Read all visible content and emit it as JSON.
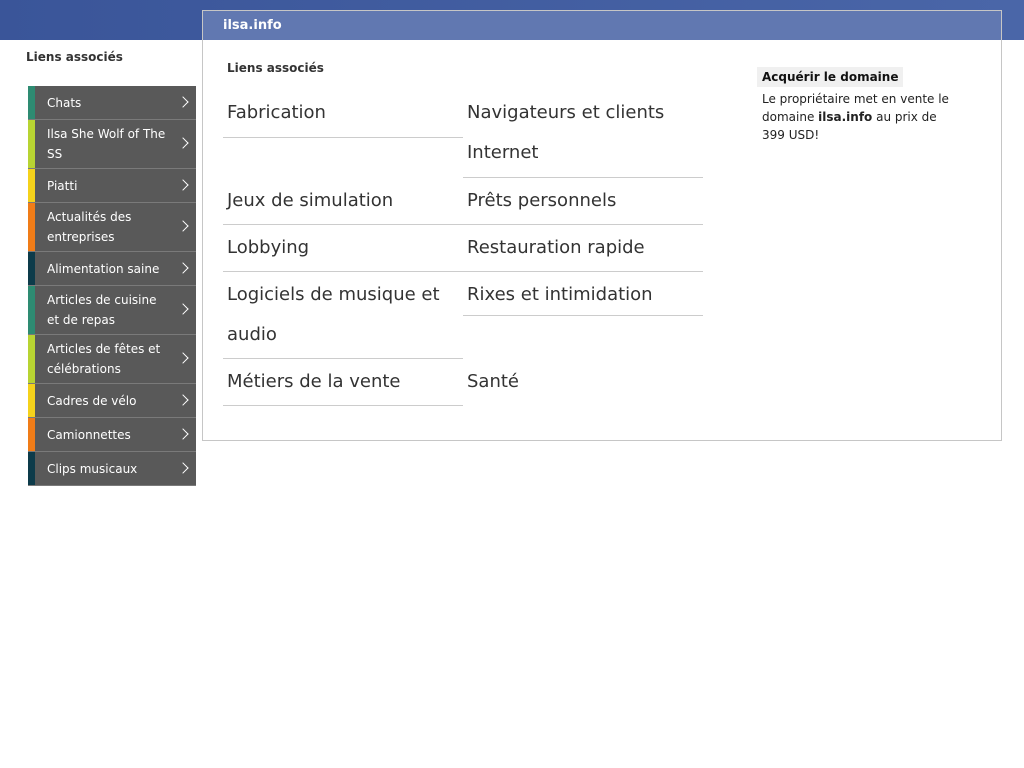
{
  "sidebar": {
    "title": "Liens associés",
    "items": [
      {
        "label": "Chats",
        "color": "#2e8b72"
      },
      {
        "label": "Ilsa She Wolf of The SS",
        "color": "#b8d432"
      },
      {
        "label": "Piatti",
        "color": "#f5d21b"
      },
      {
        "label": "Actualités des entreprises",
        "color": "#f07c18"
      },
      {
        "label": "Alimentation saine",
        "color": "#0d3b4a"
      },
      {
        "label": "Articles de cuisine et de repas",
        "color": "#2e8b72"
      },
      {
        "label": "Articles de fêtes et célébrations",
        "color": "#b8d432"
      },
      {
        "label": "Cadres de vélo",
        "color": "#f5d21b"
      },
      {
        "label": "Camionnettes",
        "color": "#f07c18"
      },
      {
        "label": "Clips musicaux",
        "color": "#0d3b4a"
      }
    ]
  },
  "panel": {
    "header": "ilsa.info",
    "heading": "Liens associés",
    "links": [
      "Fabrication",
      "Navigateurs et clients Internet",
      "Jeux de simulation",
      "Prêts personnels",
      "Lobbying",
      "Restauration rapide",
      "Logiciels de musique et audio",
      "Rixes et intimidation",
      "Métiers de la vente",
      "Santé"
    ]
  },
  "domain": {
    "title": "Acquérir le domaine",
    "text_before": "Le propriétaire met en vente le domaine ",
    "name": "ilsa.info",
    "text_after": " au prix de 399 USD!"
  },
  "colors": {
    "topbar": "#3a5599",
    "panel_header": "#6178b1",
    "sidebar_bg": "#595959"
  }
}
